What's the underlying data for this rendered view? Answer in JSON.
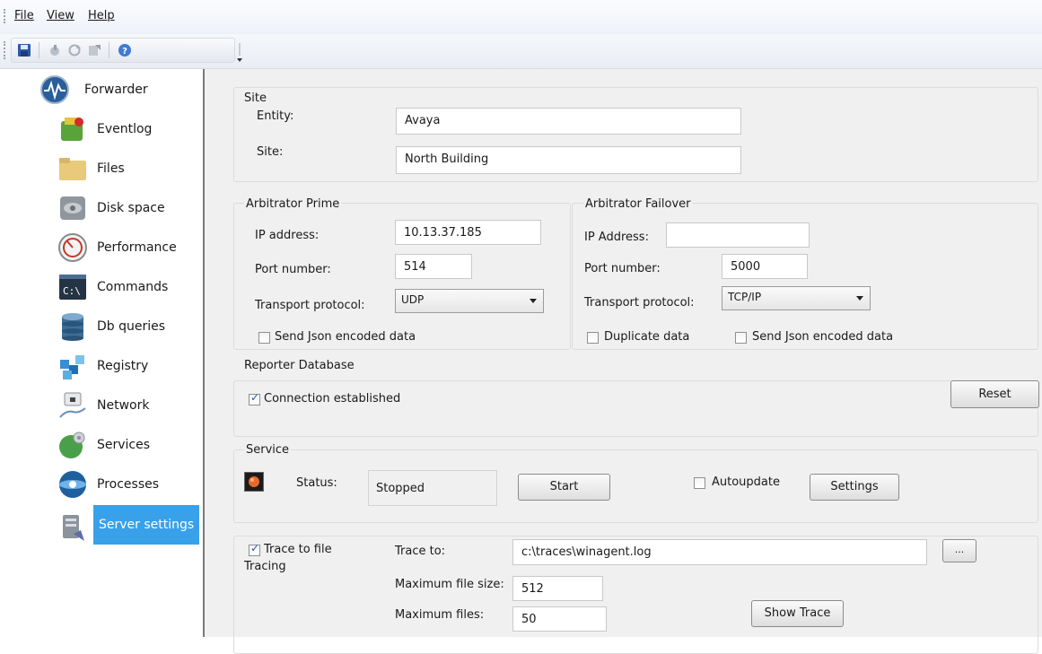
{
  "menu": {
    "file": "File",
    "view": "View",
    "help": "Help"
  },
  "toolbar": {
    "icons": [
      "save-icon",
      "import-icon",
      "refresh-icon",
      "export-icon",
      "help-icon"
    ]
  },
  "sidebar": {
    "items": [
      {
        "label": "Forwarder",
        "icon": "waveform-globe-icon"
      },
      {
        "label": "Eventlog",
        "icon": "eventlog-icon"
      },
      {
        "label": "Files",
        "icon": "folder-icon"
      },
      {
        "label": "Disk space",
        "icon": "disk-icon"
      },
      {
        "label": "Performance",
        "icon": "gauge-icon"
      },
      {
        "label": "Commands",
        "icon": "console-icon"
      },
      {
        "label": "Db queries",
        "icon": "database-icon"
      },
      {
        "label": "Registry",
        "icon": "registry-icon"
      },
      {
        "label": "Network",
        "icon": "network-icon"
      },
      {
        "label": "Services",
        "icon": "services-icon"
      },
      {
        "label": "Processes",
        "icon": "processes-icon"
      },
      {
        "label": "Server settings",
        "icon": "server-settings-icon",
        "selected": true
      }
    ]
  },
  "site": {
    "title": "Site",
    "entity_label": "Entity:",
    "entity_value": "Avaya",
    "site_label": "Site:",
    "site_value": "North Building"
  },
  "arbitrator_prime": {
    "title": "Arbitrator Prime",
    "ip_label": "IP address:",
    "ip_value": "10.13.37.185",
    "port_label": "Port number:",
    "port_value": "514",
    "transport_label": "Transport protocol:",
    "transport_value": "UDP",
    "json_label": "Send Json encoded data"
  },
  "arbitrator_failover": {
    "title": "Arbitrator Failover",
    "ip_label": "IP Address:",
    "ip_value": "",
    "port_label": "Port number:",
    "port_value": "5000",
    "transport_label": "Transport protocol:",
    "transport_value": "TCP/IP",
    "duplicate_label": "Duplicate data",
    "json_label": "Send Json encoded data"
  },
  "reporter": {
    "title": "Reporter Database",
    "connection_label": "Connection established",
    "reset_label": "Reset"
  },
  "service": {
    "title": "Service",
    "status_label": "Status:",
    "status_value": "Stopped",
    "start_label": "Start",
    "autoupdate_label": "Autoupdate",
    "settings_label": "Settings"
  },
  "tracing": {
    "title": "Tracing",
    "trace_to_file_label": "Trace to file",
    "trace_to_label": "Trace to:",
    "trace_to_value": "c:\\traces\\winagent.log",
    "browse_label": "...",
    "max_size_label": "Maximum file size:",
    "max_size_value": "512",
    "max_files_label": "Maximum files:",
    "max_files_value": "50",
    "show_trace_label": "Show Trace"
  }
}
